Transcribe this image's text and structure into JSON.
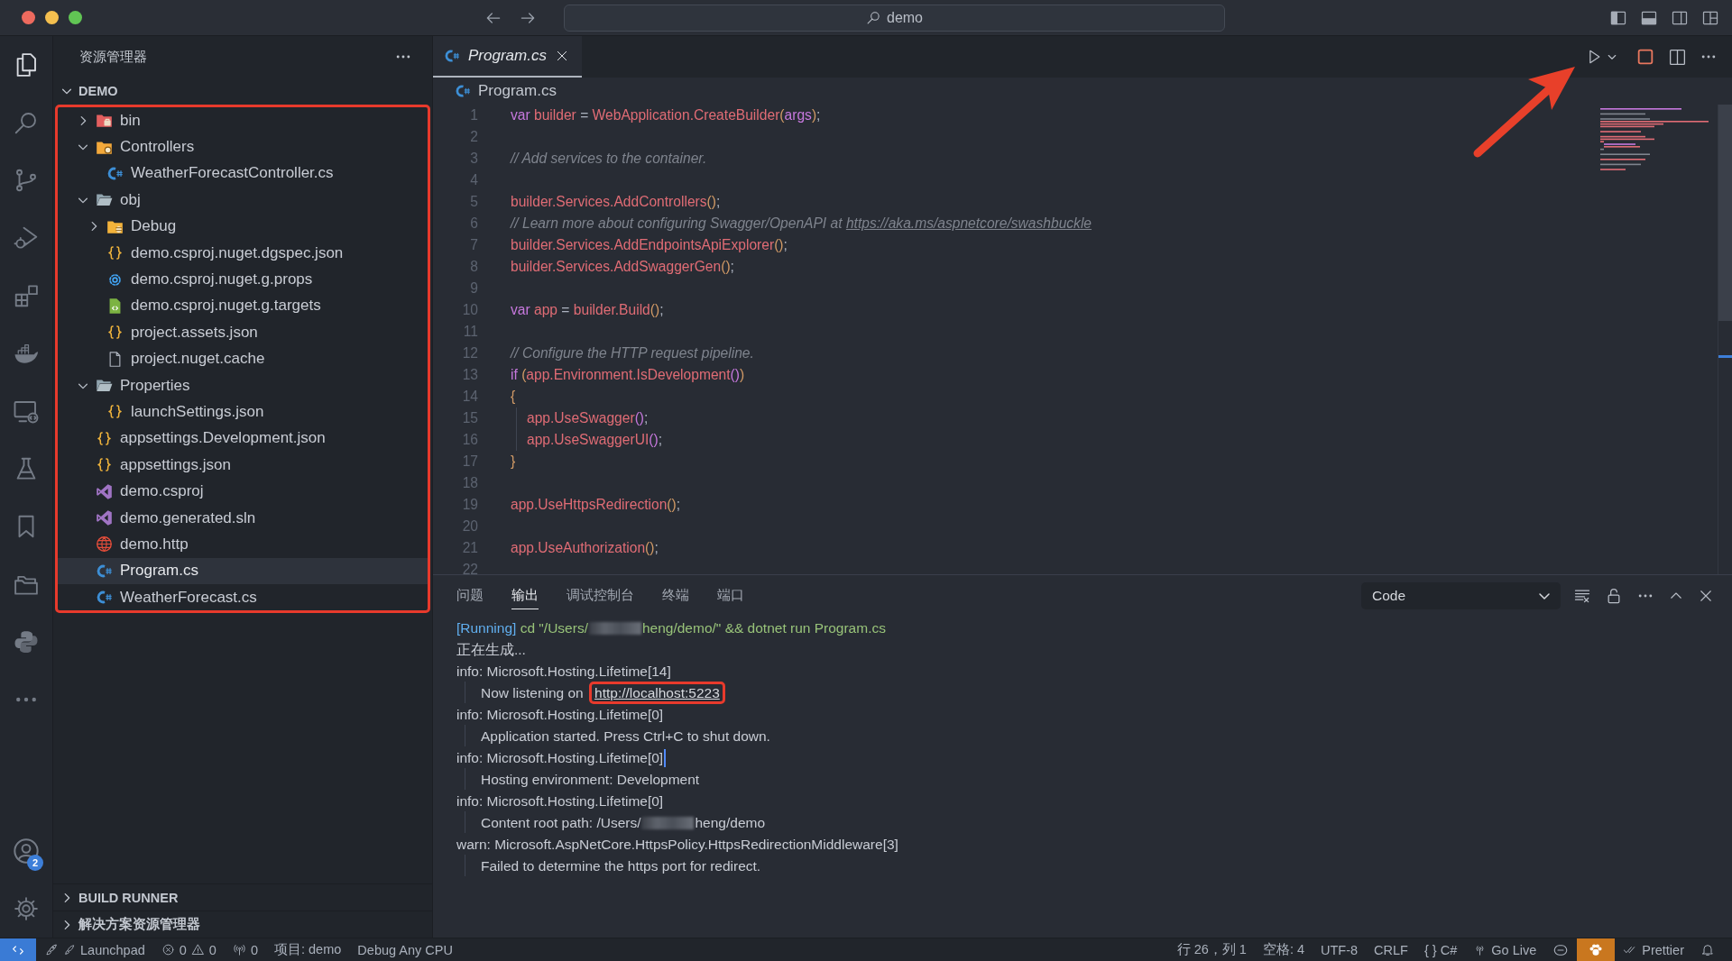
{
  "title_bar": {
    "search_text": "demo"
  },
  "activity_bar": {
    "items": [
      {
        "kind": "explorer",
        "selected": true
      },
      {
        "kind": "search",
        "selected": false
      },
      {
        "kind": "source-control",
        "selected": false
      },
      {
        "kind": "run-debug",
        "selected": false
      },
      {
        "kind": "extensions",
        "selected": false
      },
      {
        "kind": "docker",
        "selected": false
      },
      {
        "kind": "remote",
        "selected": false
      },
      {
        "kind": "testing",
        "selected": false
      },
      {
        "kind": "bookmarks",
        "selected": false
      },
      {
        "kind": "folders",
        "selected": false
      },
      {
        "kind": "python",
        "selected": false
      },
      {
        "kind": "more",
        "selected": false
      }
    ],
    "account_badge": "2"
  },
  "sidebar": {
    "title": "资源管理器",
    "sections": [
      {
        "title": "DEMO",
        "expanded": true,
        "highlighted": true,
        "tree": [
          {
            "label": "bin",
            "kind": "folder-bin",
            "expanded": false,
            "selected": false
          },
          {
            "label": "Controllers",
            "kind": "folder-controllers",
            "expanded": true,
            "selected": false,
            "children": [
              {
                "label": "WeatherForecastController.cs",
                "kind": "csharp",
                "selected": false
              }
            ]
          },
          {
            "label": "obj",
            "kind": "folder",
            "expanded": true,
            "selected": false,
            "children": [
              {
                "label": "Debug",
                "kind": "folder-debug",
                "expanded": false,
                "selected": false
              },
              {
                "label": "demo.csproj.nuget.dgspec.json",
                "kind": "json",
                "selected": false
              },
              {
                "label": "demo.csproj.nuget.g.props",
                "kind": "props",
                "selected": false
              },
              {
                "label": "demo.csproj.nuget.g.targets",
                "kind": "targets",
                "selected": false
              },
              {
                "label": "project.assets.json",
                "kind": "json",
                "selected": false
              },
              {
                "label": "project.nuget.cache",
                "kind": "file",
                "selected": false
              }
            ]
          },
          {
            "label": "Properties",
            "kind": "folder",
            "expanded": true,
            "selected": false,
            "children": [
              {
                "label": "launchSettings.json",
                "kind": "json",
                "selected": false
              }
            ]
          },
          {
            "label": "appsettings.Development.json",
            "kind": "json",
            "selected": false
          },
          {
            "label": "appsettings.json",
            "kind": "json",
            "selected": false
          },
          {
            "label": "demo.csproj",
            "kind": "vs",
            "selected": false
          },
          {
            "label": "demo.generated.sln",
            "kind": "vs",
            "selected": false
          },
          {
            "label": "demo.http",
            "kind": "http",
            "selected": false
          },
          {
            "label": "Program.cs",
            "kind": "csharp",
            "selected": true
          },
          {
            "label": "WeatherForecast.cs",
            "kind": "csharp",
            "selected": false
          }
        ]
      },
      {
        "title": "BUILD RUNNER",
        "expanded": false
      },
      {
        "title": "解决方案资源管理器",
        "expanded": false
      }
    ]
  },
  "editor": {
    "tabs": [
      {
        "label": "Program.cs",
        "kind": "csharp",
        "selected": true,
        "preview": true
      }
    ],
    "breadcrumb": {
      "label": "Program.cs",
      "kind": "csharp"
    },
    "lines": [
      {
        "number": "1",
        "tokens": [
          {
            "kind": "keyword",
            "text": "var "
          },
          {
            "kind": "ident",
            "text": "builder"
          },
          {
            "kind": "punct",
            "text": " = "
          },
          {
            "kind": "ident",
            "text": "WebApplication.CreateBuilder"
          },
          {
            "kind": "paren",
            "text": "("
          },
          {
            "kind": "param",
            "text": "args"
          },
          {
            "kind": "paren",
            "text": ")"
          },
          {
            "kind": "punct",
            "text": ";"
          }
        ]
      },
      {
        "number": "2"
      },
      {
        "number": "3",
        "tokens": [
          {
            "kind": "comment",
            "text": "// Add services to the container."
          }
        ]
      },
      {
        "number": "4"
      },
      {
        "number": "5",
        "tokens": [
          {
            "kind": "ident",
            "text": "builder.Services.AddControllers"
          },
          {
            "kind": "paren",
            "text": "()"
          },
          {
            "kind": "punct",
            "text": ";"
          }
        ]
      },
      {
        "number": "6",
        "tokens": [
          {
            "kind": "comment",
            "text": "// Learn more about configuring Swagger/OpenAPI at "
          },
          {
            "kind": "link",
            "text": "https://aka.ms/aspnetcore/swashbuckle"
          }
        ]
      },
      {
        "number": "7",
        "tokens": [
          {
            "kind": "ident",
            "text": "builder.Services.AddEndpointsApiExplorer"
          },
          {
            "kind": "paren",
            "text": "()"
          },
          {
            "kind": "punct",
            "text": ";"
          }
        ]
      },
      {
        "number": "8",
        "tokens": [
          {
            "kind": "ident",
            "text": "builder.Services.AddSwaggerGen"
          },
          {
            "kind": "paren",
            "text": "()"
          },
          {
            "kind": "punct",
            "text": ";"
          }
        ]
      },
      {
        "number": "9"
      },
      {
        "number": "10",
        "tokens": [
          {
            "kind": "keyword",
            "text": "var "
          },
          {
            "kind": "ident",
            "text": "app"
          },
          {
            "kind": "punct",
            "text": " = "
          },
          {
            "kind": "ident",
            "text": "builder.Build"
          },
          {
            "kind": "paren",
            "text": "()"
          },
          {
            "kind": "punct",
            "text": ";"
          }
        ]
      },
      {
        "number": "11"
      },
      {
        "number": "12",
        "tokens": [
          {
            "kind": "comment",
            "text": "// Configure the HTTP request pipeline."
          }
        ]
      },
      {
        "number": "13",
        "tokens": [
          {
            "kind": "keyword",
            "text": "if "
          },
          {
            "kind": "paren",
            "text": "("
          },
          {
            "kind": "ident",
            "text": "app.Environment.IsDevelopment"
          },
          {
            "kind": "paren2",
            "text": "()"
          },
          {
            "kind": "paren",
            "text": ")"
          }
        ]
      },
      {
        "number": "14",
        "tokens": [
          {
            "kind": "paren",
            "text": "{"
          }
        ]
      },
      {
        "number": "15",
        "indented": true,
        "tokens": [
          {
            "kind": "ident",
            "text": "app.UseSwagger"
          },
          {
            "kind": "paren2",
            "text": "()"
          },
          {
            "kind": "punct",
            "text": ";"
          }
        ]
      },
      {
        "number": "16",
        "indented": true,
        "tokens": [
          {
            "kind": "ident",
            "text": "app.UseSwaggerUI"
          },
          {
            "kind": "paren2",
            "text": "()"
          },
          {
            "kind": "punct",
            "text": ";"
          }
        ]
      },
      {
        "number": "17",
        "tokens": [
          {
            "kind": "paren",
            "text": "}"
          }
        ]
      },
      {
        "number": "18"
      },
      {
        "number": "19",
        "tokens": [
          {
            "kind": "ident",
            "text": "app.UseHttpsRedirection"
          },
          {
            "kind": "paren",
            "text": "()"
          },
          {
            "kind": "punct",
            "text": ";"
          }
        ]
      },
      {
        "number": "20"
      },
      {
        "number": "21",
        "tokens": [
          {
            "kind": "ident",
            "text": "app.UseAuthorization"
          },
          {
            "kind": "paren",
            "text": "()"
          },
          {
            "kind": "punct",
            "text": ";"
          }
        ]
      },
      {
        "number": "22"
      }
    ]
  },
  "panel": {
    "tabs": [
      {
        "label": "问题",
        "selected": false
      },
      {
        "label": "输出",
        "selected": true
      },
      {
        "label": "调试控制台",
        "selected": false
      },
      {
        "label": "终端",
        "selected": false
      },
      {
        "label": "端口",
        "selected": false
      }
    ],
    "channel": "Code",
    "output": [
      {
        "kind": "command",
        "tag": "[Running]",
        "text": "cd \"/Users/",
        "after_redaction": "heng/demo/\" && dotnet run Program.cs"
      },
      {
        "kind": "info",
        "text": "正在生成..."
      },
      {
        "kind": "info",
        "text": "info: Microsoft.Hosting.Lifetime[14]"
      },
      {
        "kind": "detail",
        "text": "Now listening on",
        "link": "http://localhost:5223",
        "highlighted": true
      },
      {
        "kind": "info",
        "text": "info: Microsoft.Hosting.Lifetime[0]"
      },
      {
        "kind": "detail",
        "text": "Application started. Press Ctrl+C to shut down."
      },
      {
        "kind": "info",
        "text": "info: Microsoft.Hosting.Lifetime[0]",
        "cursor": true
      },
      {
        "kind": "detail",
        "text": "Hosting environment: Development"
      },
      {
        "kind": "info",
        "text": "info: Microsoft.Hosting.Lifetime[0]"
      },
      {
        "kind": "detail",
        "text": "Content root path: /Users/",
        "after_redaction": "heng/demo"
      },
      {
        "kind": "info",
        "text": "warn: Microsoft.AspNetCore.HttpsPolicy.HttpsRedirectionMiddleware[3]"
      },
      {
        "kind": "detail",
        "text": "Failed to determine the https port for redirect."
      }
    ]
  },
  "status_bar": {
    "left": [
      {
        "kind": "remote"
      },
      {
        "kind": "launchpad",
        "text": "Launchpad"
      },
      {
        "kind": "problems",
        "errors": "0",
        "warnings": "0"
      },
      {
        "kind": "ports",
        "text": "0"
      },
      {
        "kind": "text",
        "text": "项目: demo"
      },
      {
        "kind": "text",
        "text": "Debug Any CPU"
      }
    ],
    "right": [
      {
        "kind": "text",
        "text": "行 26，列 1"
      },
      {
        "kind": "text",
        "text": "空格: 4"
      },
      {
        "kind": "text",
        "text": "UTF-8"
      },
      {
        "kind": "text",
        "text": "CRLF"
      },
      {
        "kind": "language",
        "icon": "{ }",
        "text": "C#"
      },
      {
        "kind": "golive",
        "text": "Go Live"
      },
      {
        "kind": "assistant"
      },
      {
        "kind": "extension"
      },
      {
        "kind": "prettier",
        "text": "Prettier"
      },
      {
        "kind": "bell"
      }
    ]
  }
}
